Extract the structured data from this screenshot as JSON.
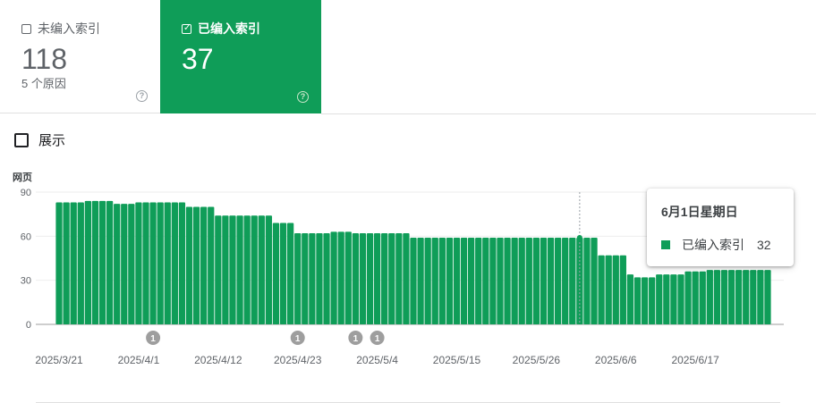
{
  "cards": {
    "unindexed": {
      "label": "未编入索引",
      "value": "118",
      "sub": "5 个原因",
      "checked": false
    },
    "indexed": {
      "label": "已编入索引",
      "value": "37",
      "checked": true
    }
  },
  "toggle": {
    "label": "展示",
    "checked": false
  },
  "colors": {
    "accent": "#0f9d58",
    "bar": "#0f9d58",
    "marker": "#9e9e9e"
  },
  "icons": {
    "help": "help-circle-icon",
    "checkbox": "checkbox-icon"
  },
  "chart_data": {
    "type": "bar",
    "ylabel": "网页",
    "ylim": [
      0,
      90
    ],
    "yticks": [
      0,
      30,
      60,
      90
    ],
    "x_start": "2025/3/21",
    "x_labels": [
      "2025/3/21",
      "2025/4/1",
      "2025/4/12",
      "2025/4/23",
      "2025/5/4",
      "2025/5/15",
      "2025/5/26",
      "2025/6/6",
      "2025/6/17"
    ],
    "series": [
      {
        "name": "已编入索引",
        "values": [
          83,
          83,
          83,
          83,
          84,
          84,
          84,
          84,
          82,
          82,
          82,
          83,
          83,
          83,
          83,
          83,
          83,
          83,
          80,
          80,
          80,
          80,
          74,
          74,
          74,
          74,
          74,
          74,
          74,
          74,
          69,
          69,
          69,
          62,
          62,
          62,
          62,
          62,
          63,
          63,
          63,
          62,
          62,
          62,
          62,
          62,
          62,
          62,
          62,
          59,
          59,
          59,
          59,
          59,
          59,
          59,
          59,
          59,
          59,
          59,
          59,
          59,
          59,
          59,
          59,
          59,
          59,
          59,
          59,
          59,
          59,
          59,
          59,
          59,
          59,
          47,
          47,
          47,
          47,
          34,
          32,
          32,
          32,
          34,
          34,
          34,
          34,
          36,
          36,
          36,
          37,
          37,
          37,
          37,
          37,
          37,
          37,
          37,
          37
        ]
      }
    ],
    "annotations": [
      {
        "date": "2025/4/3",
        "label": "1"
      },
      {
        "date": "2025/4/23",
        "label": "1"
      },
      {
        "date": "2025/5/1",
        "label": "1"
      },
      {
        "date": "2025/5/4",
        "label": "1"
      }
    ],
    "tooltip": {
      "title": "6月1日星期日",
      "series": "已编入索引",
      "value": "32"
    }
  }
}
